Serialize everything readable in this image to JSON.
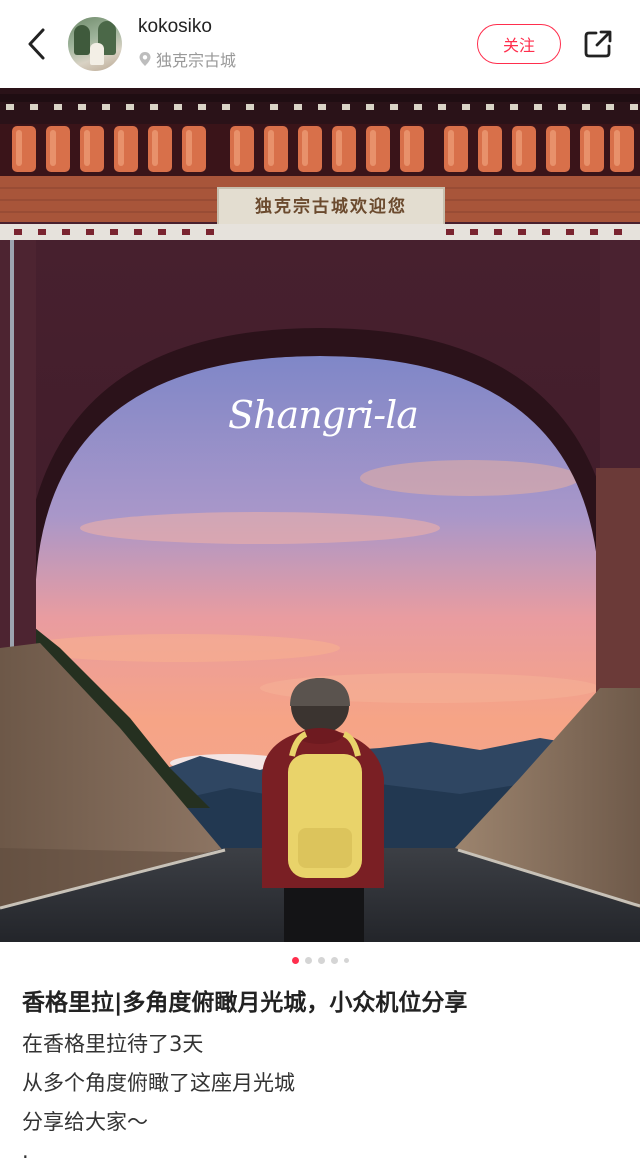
{
  "header": {
    "username": "kokosiko",
    "location": "独克宗古城",
    "follow_label": "关注"
  },
  "photo": {
    "gate_sign": "独克宗古城欢迎您",
    "overlay_script": "Shangri-la",
    "dots": {
      "total": 5,
      "active_index": 0
    }
  },
  "post": {
    "title": "香格里拉|多角度俯瞰月光城，小众机位分享",
    "lines": [
      "在香格里拉待了3天",
      "从多个角度俯瞰了这座月光城",
      "分享给大家～",
      "·"
    ]
  },
  "colors": {
    "accent": "#ff2e4d",
    "muted_text": "#999999",
    "body_text": "#333333"
  },
  "icons": [
    "back-arrow-icon",
    "location-pin-icon",
    "share-icon"
  ]
}
